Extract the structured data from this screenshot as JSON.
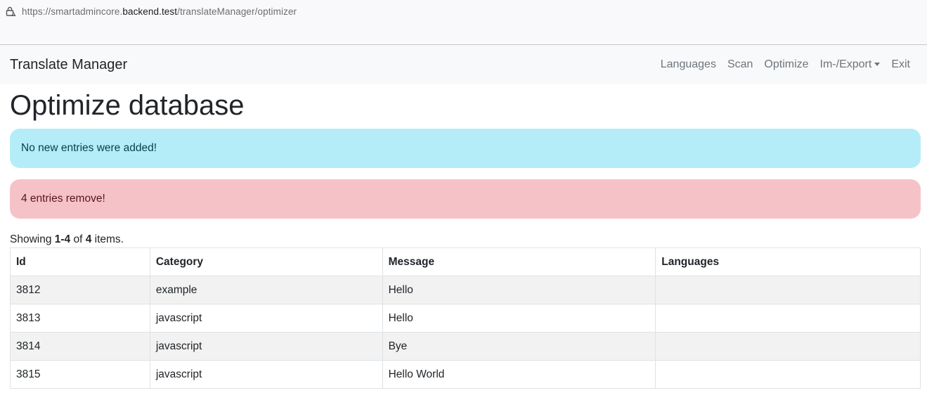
{
  "browser": {
    "url_prefix": "https://smartadmincore.",
    "url_host": "backend.test",
    "url_path": "/translateManager/optimizer",
    "lock_icon": "lock-warning-icon"
  },
  "navbar": {
    "brand": "Translate Manager",
    "links": [
      {
        "label": "Languages"
      },
      {
        "label": "Scan"
      },
      {
        "label": "Optimize"
      },
      {
        "label": "Im-/Export"
      },
      {
        "label": "Exit"
      }
    ]
  },
  "page": {
    "title": "Optimize database"
  },
  "alerts": {
    "info": "No new entries were added!",
    "danger": "4 entries remove!"
  },
  "summary": {
    "prefix": "Showing ",
    "range": "1-4",
    "of": " of ",
    "total": "4",
    "suffix": " items."
  },
  "table": {
    "headers": [
      "Id",
      "Category",
      "Message",
      "Languages"
    ],
    "rows": [
      [
        "3812",
        "example",
        "Hello",
        ""
      ],
      [
        "3813",
        "javascript",
        "Hello",
        ""
      ],
      [
        "3814",
        "javascript",
        "Bye",
        ""
      ],
      [
        "3815",
        "javascript",
        "Hello World",
        ""
      ]
    ]
  },
  "colors": {
    "navbar_bg": "#f8f9fa",
    "alert_info_bg": "#b4edf8",
    "alert_danger_bg": "#f5c3c7",
    "stripe_bg": "#f2f2f2"
  }
}
